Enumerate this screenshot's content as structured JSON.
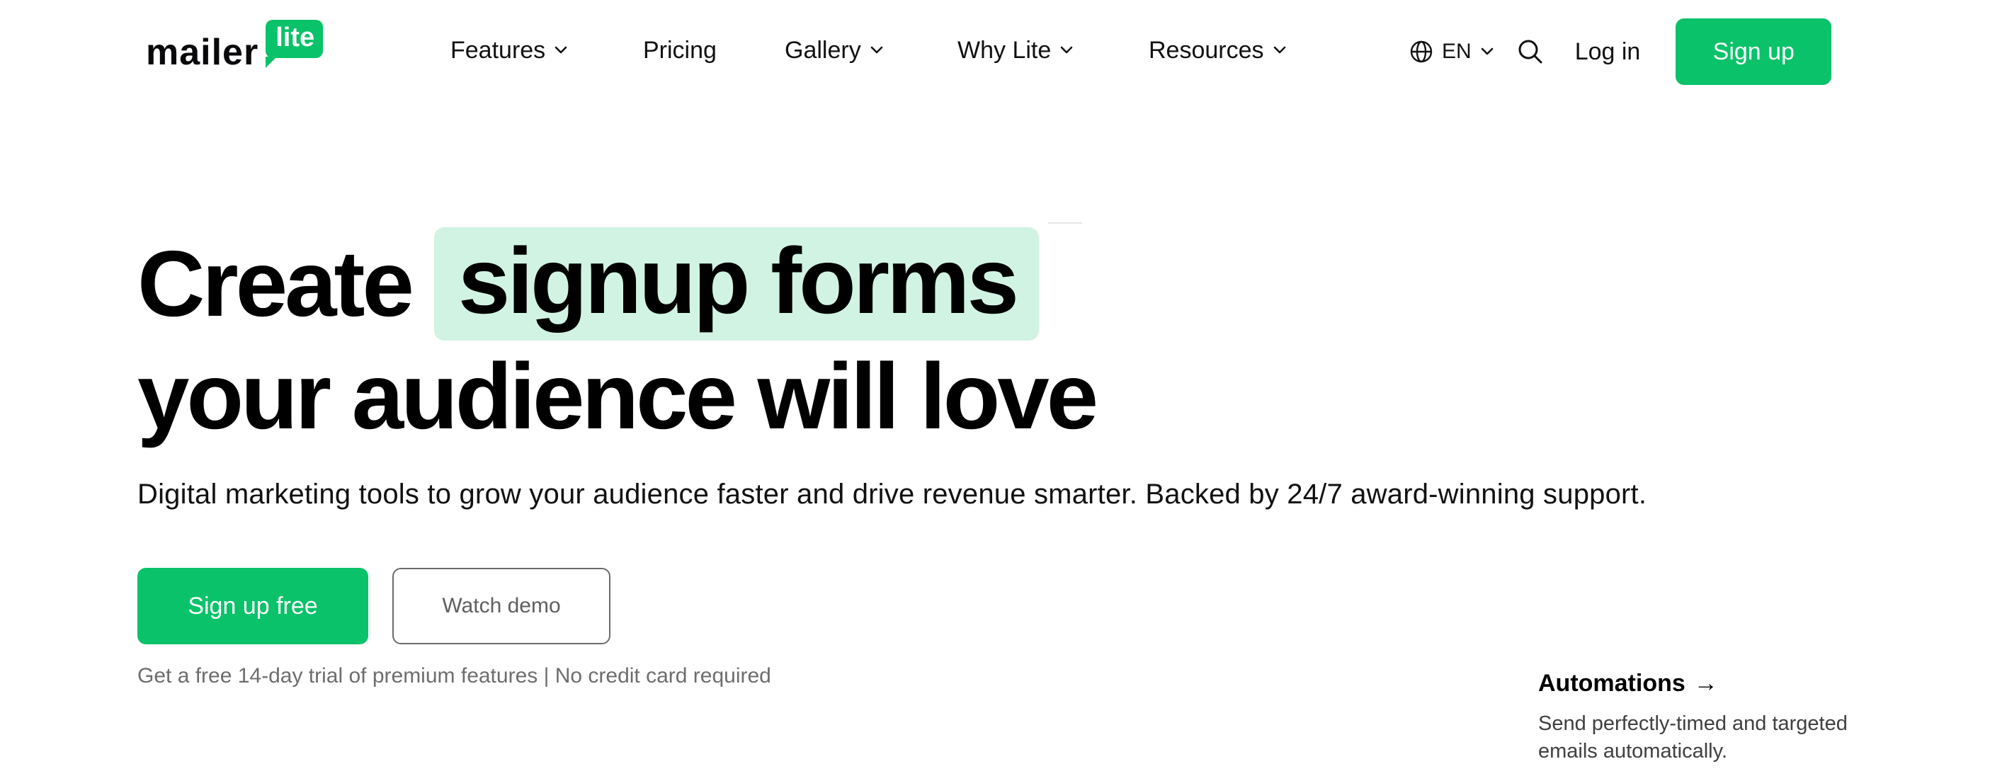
{
  "brand": {
    "word": "mailer",
    "badge": "lite",
    "accent_color": "#09c269",
    "highlight_color": "#d1f3e3"
  },
  "nav": {
    "items": [
      {
        "label": "Features",
        "dropdown": true
      },
      {
        "label": "Pricing",
        "dropdown": false
      },
      {
        "label": "Gallery",
        "dropdown": true
      },
      {
        "label": "Why Lite",
        "dropdown": true
      },
      {
        "label": "Resources",
        "dropdown": true
      }
    ]
  },
  "header": {
    "language": "EN",
    "language_icon": "globe-icon",
    "search_icon": "search-icon",
    "login_label": "Log in",
    "signup_label": "Sign up"
  },
  "hero": {
    "line1_prefix": "Create",
    "line1_highlight": "signup forms",
    "line2": "your audience will love",
    "subtitle": "Digital marketing tools to grow your audience faster and drive revenue smarter. Backed by 24/7 award-winning support.",
    "primary_cta": "Sign up free",
    "secondary_cta": "Watch demo",
    "trial_note": "Get a free 14-day trial of premium features | No credit card required"
  },
  "feature_card": {
    "title": "Automations",
    "arrow": "→",
    "description": "Send perfectly-timed and targeted emails automatically."
  }
}
